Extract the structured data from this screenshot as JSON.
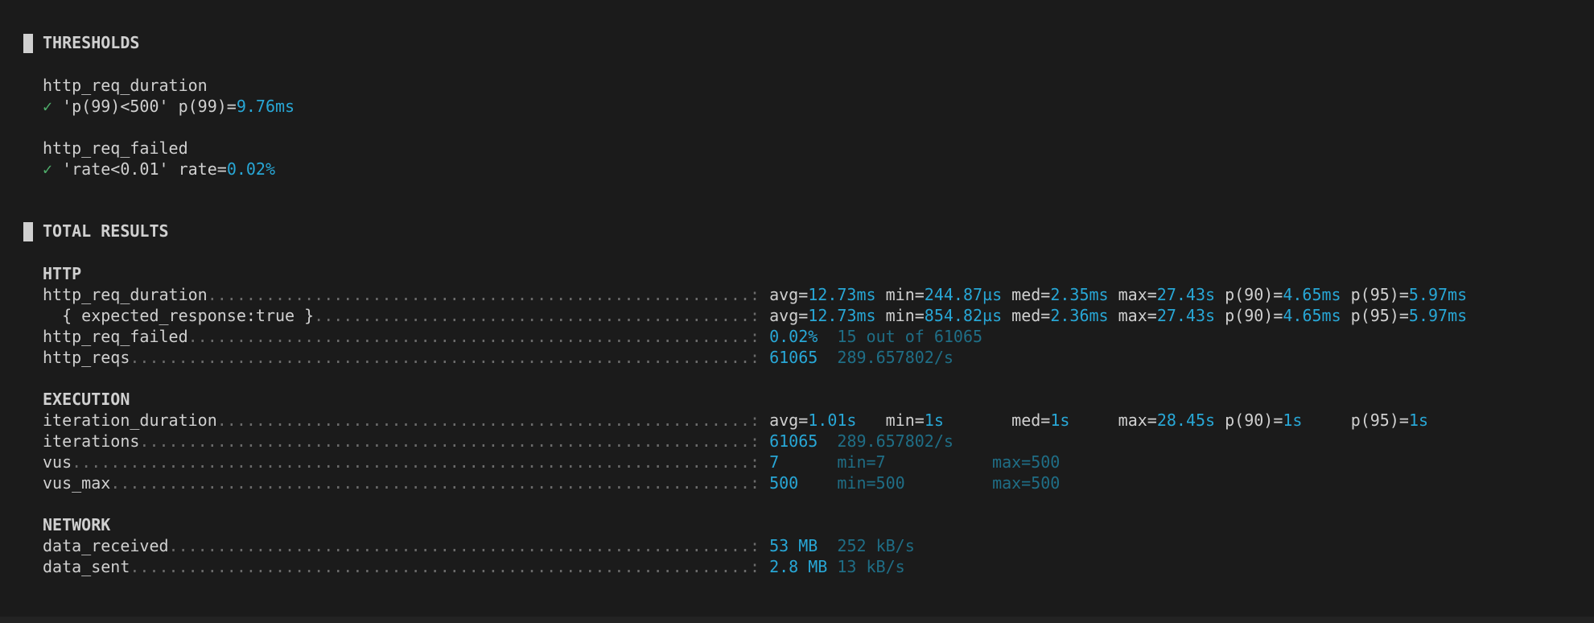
{
  "thresholds": {
    "title": "THRESHOLDS",
    "items": [
      {
        "metric": "http_req_duration",
        "check": "✓",
        "condition": "'p(99)<500'",
        "stat_label": "p(99)=",
        "stat_value": "9.76ms"
      },
      {
        "metric": "http_req_failed",
        "check": "✓",
        "condition": "'rate<0.01'",
        "stat_label": "rate=",
        "stat_value": "0.02%"
      }
    ]
  },
  "total": {
    "title": "TOTAL RESULTS",
    "http": {
      "title": "HTTP",
      "rows": {
        "req_duration": {
          "name": "http_req_duration",
          "avg_l": "avg=",
          "avg": "12.73ms",
          "min_l": "min=",
          "min": "244.87µs",
          "med_l": "med=",
          "med": "2.35ms",
          "max_l": "max=",
          "max": "27.43s",
          "p90_l": "p(90)=",
          "p90": "4.65ms",
          "p95_l": "p(95)=",
          "p95": "5.97ms"
        },
        "expected": {
          "name": "{ expected_response:true }",
          "avg_l": "avg=",
          "avg": "12.73ms",
          "min_l": "min=",
          "min": "854.82µs",
          "med_l": "med=",
          "med": "2.36ms",
          "max_l": "max=",
          "max": "27.43s",
          "p90_l": "p(90)=",
          "p90": "4.65ms",
          "p95_l": "p(95)=",
          "p95": "5.97ms"
        },
        "req_failed": {
          "name": "http_req_failed",
          "value": "0.02%",
          "extra": "15 out of 61065"
        },
        "reqs": {
          "name": "http_reqs",
          "value": "61065",
          "extra": "289.657802/s"
        }
      }
    },
    "execution": {
      "title": "EXECUTION",
      "rows": {
        "iteration_duration": {
          "name": "iteration_duration",
          "avg_l": "avg=",
          "avg": "1.01s",
          "min_l": "min=",
          "min": "1s",
          "med_l": "med=",
          "med": "1s",
          "max_l": "max=",
          "max": "28.45s",
          "p90_l": "p(90)=",
          "p90": "1s",
          "p95_l": "p(95)=",
          "p95": "1s"
        },
        "iterations": {
          "name": "iterations",
          "value": "61065",
          "extra": "289.657802/s"
        },
        "vus": {
          "name": "vus",
          "value": "7",
          "min": "min=7",
          "max": "max=500"
        },
        "vus_max": {
          "name": "vus_max",
          "value": "500",
          "min": "min=500",
          "max": "max=500"
        }
      }
    },
    "network": {
      "title": "NETWORK",
      "rows": {
        "data_received": {
          "name": "data_received",
          "value": "53 MB",
          "extra": "252 kB/s"
        },
        "data_sent": {
          "name": "data_sent",
          "value": "2.8 MB",
          "extra": "13 kB/s"
        }
      }
    }
  }
}
